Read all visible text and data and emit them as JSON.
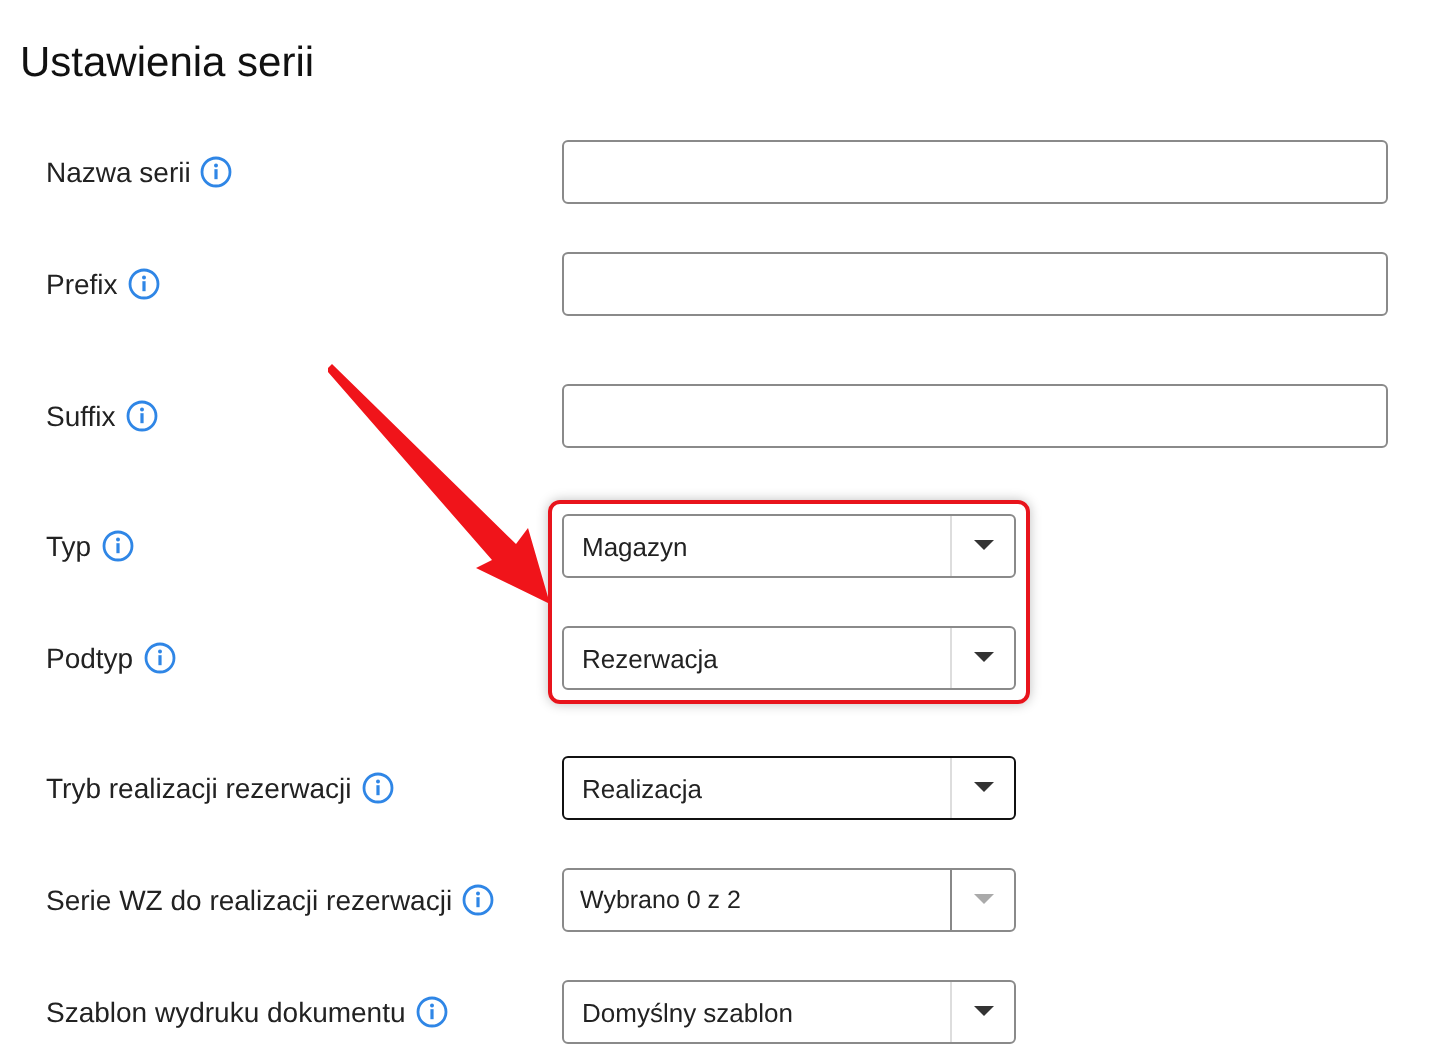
{
  "title": "Ustawienia serii",
  "fields": [
    {
      "label": "Nazwa serii",
      "kind": "text"
    },
    {
      "label": "Prefix",
      "kind": "text"
    },
    {
      "label": "Suffix",
      "kind": "text"
    },
    {
      "kind": "callout",
      "children": [
        {
          "label": "Typ",
          "kind": "select",
          "value": "Magazyn",
          "focused": false
        },
        {
          "label": "Podtyp",
          "kind": "select",
          "value": "Rezerwacja",
          "focused": false
        }
      ]
    },
    {
      "label": "Tryb realizacji rezerwacji",
      "kind": "select",
      "value": "Realizacja",
      "focused": true
    },
    {
      "label": "Serie WZ do realizacji rezerwacji",
      "kind": "multiselect",
      "value": "Wybrano 0 z 2",
      "focused": false
    },
    {
      "label": "Szablon wydruku dokumentu",
      "kind": "select",
      "value": "Domyślny szablon",
      "focused": false
    }
  ]
}
